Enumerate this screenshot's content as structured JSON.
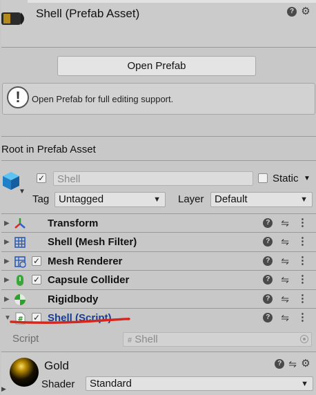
{
  "header": {
    "title": "Shell (Prefab Asset)",
    "help_icon": "?",
    "gear_icon": "⚙"
  },
  "open_prefab_button": "Open Prefab",
  "help_box": {
    "icon": "!",
    "text": "Open Prefab for full editing support."
  },
  "root_label": "Root in Prefab Asset",
  "gameobject": {
    "active_check": "✓",
    "name": "Shell",
    "static_label": "Static",
    "tag_label": "Tag",
    "tag_value": "Untagged",
    "layer_label": "Layer",
    "layer_value": "Default"
  },
  "components": [
    {
      "label": "Transform",
      "icon": "transform-icon",
      "checkbox": false
    },
    {
      "label": "Shell (Mesh Filter)",
      "icon": "mesh-filter-icon",
      "checkbox": false
    },
    {
      "label": "Mesh Renderer",
      "icon": "mesh-renderer-icon",
      "checkbox": true
    },
    {
      "label": "Capsule Collider",
      "icon": "capsule-collider-icon",
      "checkbox": true
    },
    {
      "label": "Rigidbody",
      "icon": "rigidbody-icon",
      "checkbox": false
    },
    {
      "label": "Shell (Script)",
      "icon": "script-icon",
      "checkbox": true
    }
  ],
  "script": {
    "label": "Script",
    "value": "Shell",
    "hash": "#"
  },
  "material": {
    "name": "Gold",
    "shader_label": "Shader",
    "shader_value": "Standard"
  },
  "colors": {
    "script_label": "#1a3d8f",
    "annotation_red": "#d9261c"
  }
}
